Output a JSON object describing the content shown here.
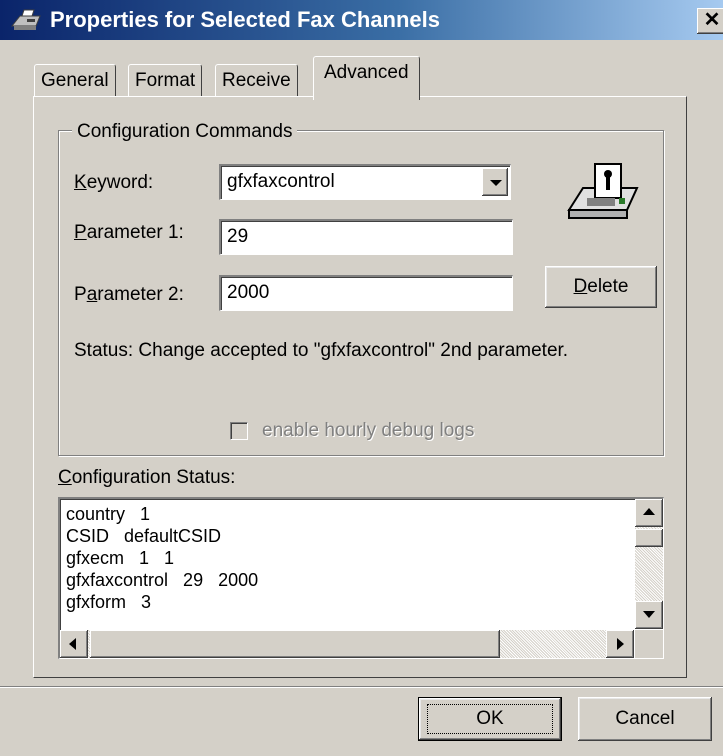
{
  "window": {
    "title": "Properties for Selected Fax Channels",
    "close_glyph": "✕",
    "icon": "fax-machine-icon"
  },
  "tabs": [
    {
      "label": "General",
      "active": false
    },
    {
      "label": "Format",
      "active": false
    },
    {
      "label": "Receive",
      "active": false
    },
    {
      "label": "Advanced",
      "active": true
    }
  ],
  "config_commands": {
    "group_label": "Configuration Commands",
    "keyword_label_accel": "K",
    "keyword_label_rest": "eyword:",
    "keyword_value": "gfxfaxcontrol",
    "param1_label_accel": "P",
    "param1_label_rest": "arameter 1:",
    "param1_value": "29",
    "param2_label_pre": "P",
    "param2_label_accel": "a",
    "param2_label_rest": "rameter 2:",
    "param2_value": "2000",
    "delete_accel": "D",
    "delete_rest": "elete",
    "status_text": "Status: Change accepted to \"gfxfaxcontrol\" 2nd parameter.",
    "debug_checkbox_label": "enable hourly debug logs",
    "debug_checkbox_checked": false,
    "debug_checkbox_enabled": false,
    "fax_icon": "fax-machine-icon"
  },
  "config_status": {
    "label_accel": "C",
    "label_rest": "onfiguration Status:",
    "lines": [
      "country   1",
      "CSID   defaultCSID",
      "gfxecm   1   1",
      "gfxfaxcontrol   29   2000",
      "gfxform   3"
    ]
  },
  "footer": {
    "ok_label": "OK",
    "cancel_label": "Cancel"
  },
  "colors": {
    "titlebar_start": "#0a246a",
    "titlebar_end": "#a6caf0",
    "face": "#d4d0c8"
  }
}
